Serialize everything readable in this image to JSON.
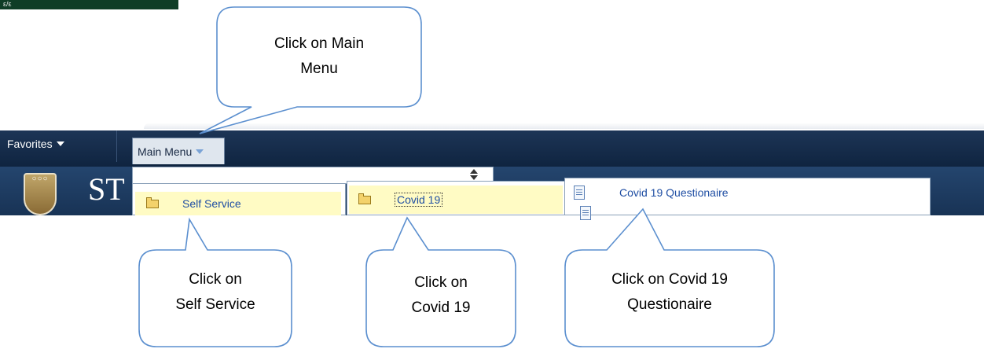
{
  "header": {
    "logo_strip_text": "ε/ε"
  },
  "nav": {
    "favorites_label": "Favorites",
    "main_menu_label": "Main Menu"
  },
  "banner": {
    "brand_text": "ST"
  },
  "menu": {
    "level1": {
      "items": [
        {
          "label": "Self Service",
          "icon": "folder-icon"
        }
      ]
    },
    "level2": {
      "items": [
        {
          "label": "Covid 19",
          "icon": "folder-icon"
        }
      ]
    },
    "level3": {
      "items": [
        {
          "label": "Covid 19 Questionaire",
          "icon": "document-icon"
        }
      ]
    }
  },
  "callouts": [
    {
      "line1": "Click on Main",
      "line2": "Menu"
    },
    {
      "line1": "Click on",
      "line2": "Self Service"
    },
    {
      "line1": "Click on",
      "line2": "Covid 19"
    },
    {
      "line1": "Click on Covid 19",
      "line2": "Questionaire"
    }
  ],
  "colors": {
    "nav_bar": "#1d3556",
    "menu_highlight": "#fffbc4",
    "menu_link": "#1f4ea3",
    "callout_border": "#5b8fcf"
  }
}
